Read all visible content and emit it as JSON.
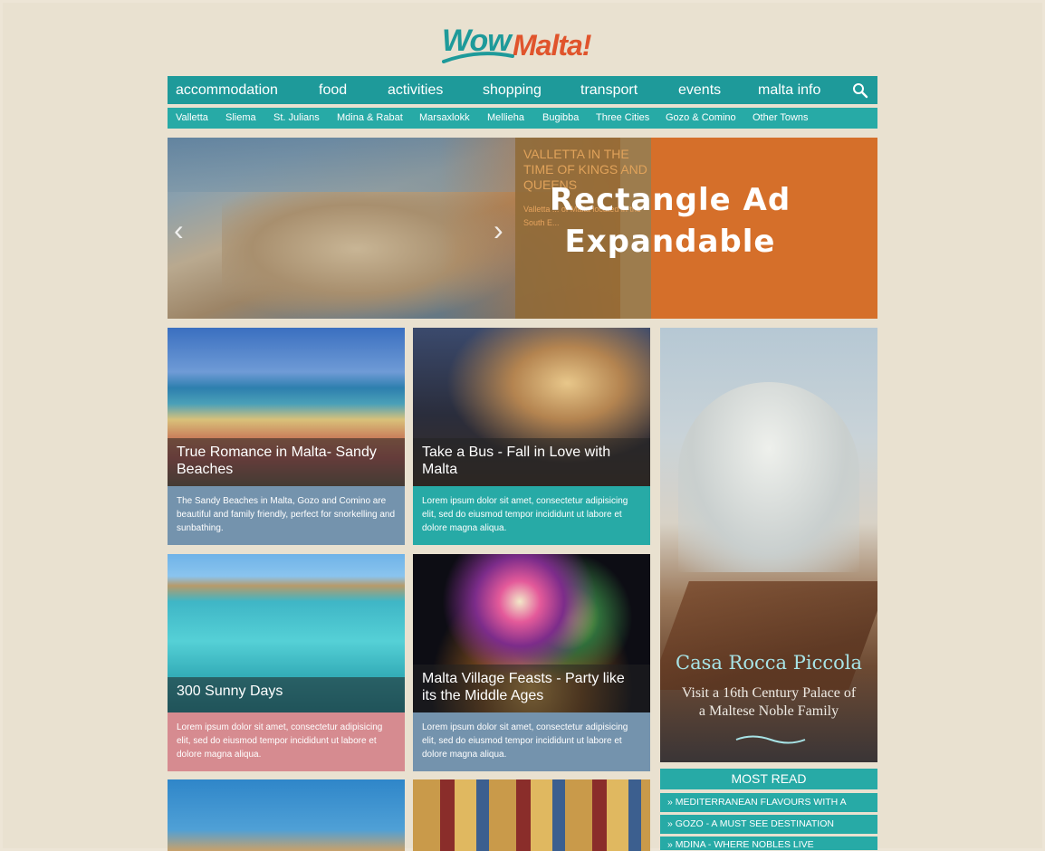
{
  "logo": {
    "part1": "Wow",
    "part2": "Malta!"
  },
  "nav": {
    "items": [
      "accommodation",
      "food",
      "activities",
      "shopping",
      "transport",
      "events",
      "malta info"
    ],
    "search_icon": "search-icon"
  },
  "subnav": {
    "items": [
      "Valletta",
      "Sliema",
      "St. Julians",
      "Mdina & Rabat",
      "Marsaxlokk",
      "Mellieha",
      "Bugibba",
      "Three Cities",
      "Gozo & Comino",
      "Other Towns"
    ]
  },
  "hero": {
    "slide_title": "VALLETTA IN THE TIME OF KINGS AND QUEENS",
    "slide_desc": "Valletta ... of Malta located in the South E...",
    "ad_line1": "Rectangle Ad",
    "ad_line2": "Expandable",
    "prev_icon": "chevron-left-icon",
    "next_icon": "chevron-right-icon"
  },
  "cards": [
    {
      "title": "True Romance in Malta- Sandy Beaches",
      "text": "The Sandy Beaches in Malta, Gozo and Comino are beautiful and family friendly, perfect for snorkelling and sunbathing.",
      "color": "#7493ad"
    },
    {
      "title": "Take a Bus - Fall in Love with Malta",
      "text": "Lorem ipsum dolor sit amet, consectetur adipisicing elit, sed do eiusmod tempor incididunt ut labore et dolore magna aliqua.",
      "color": "#27aaa6"
    },
    {
      "title": "300 Sunny Days",
      "text": "Lorem ipsum dolor sit amet, consectetur adipisicing elit, sed do eiusmod tempor incididunt ut labore et dolore magna aliqua.",
      "color": "#d68b90"
    },
    {
      "title": "Malta Village Feasts - Party like its the Middle Ages",
      "text": "Lorem ipsum dolor sit amet, consectetur adipisicing elit, sed do eiusmod tempor incididunt ut labore et dolore magna aliqua.",
      "color": "#7493ad"
    }
  ],
  "side_ad": {
    "title": "Casa Rocca Piccola",
    "subtitle": "Visit a 16th Century Palace of a Maltese Noble Family"
  },
  "most_read": {
    "heading": "MOST READ",
    "items": [
      "» MEDITERRANEAN FLAVOURS WITH A",
      "» GOZO - A MUST SEE DESTINATION",
      "» MDINA - WHERE NOBLES LIVE"
    ]
  }
}
